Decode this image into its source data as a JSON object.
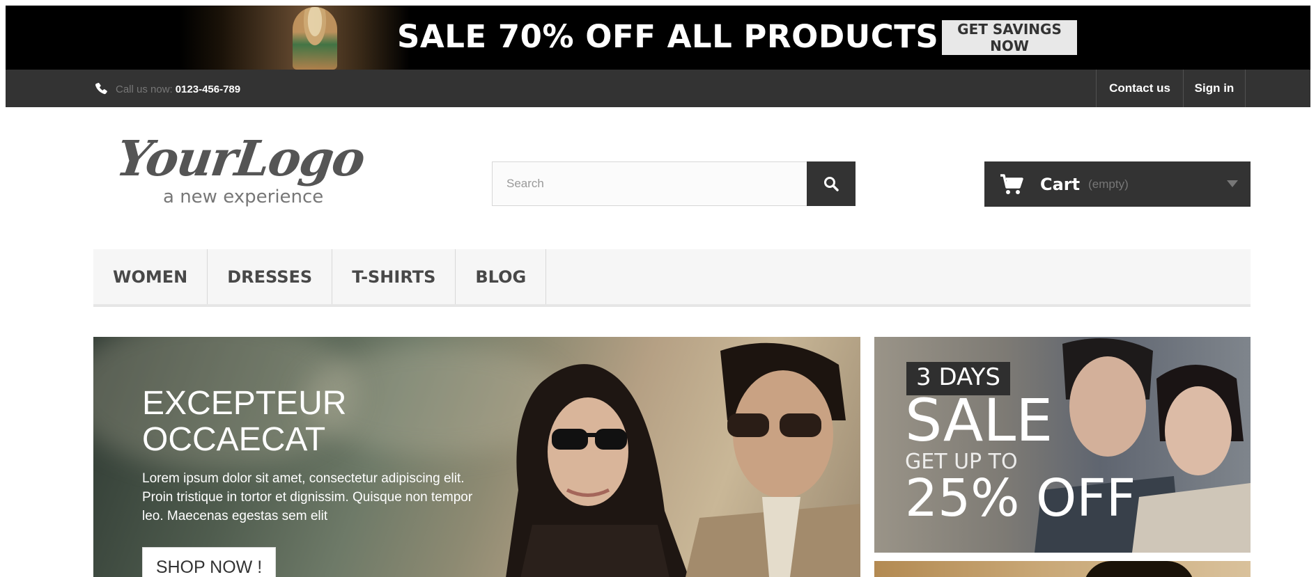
{
  "promo": {
    "headline": "SALE 70% OFF ALL PRODUCTS",
    "button": "GET SAVINGS NOW"
  },
  "topbar": {
    "call_label": "Call us now:",
    "phone": "0123-456-789",
    "contact": "Contact us",
    "signin": "Sign in"
  },
  "header": {
    "logo_script": "YourLogo",
    "logo_tagline": "a new experience",
    "search_placeholder": "Search",
    "cart_label": "Cart",
    "cart_status": "(empty)"
  },
  "nav": {
    "items": [
      "WOMEN",
      "DRESSES",
      "T-SHIRTS",
      "BLOG"
    ]
  },
  "slider": {
    "title_line1": "EXCEPTEUR",
    "title_line2": "OCCAECAT",
    "body": "Lorem ipsum dolor sit amet, consectetur adipiscing elit. Proin tristique in tortor et dignissim. Quisque non tempor leo. Maecenas egestas sem elit",
    "button": "SHOP NOW !"
  },
  "side_banner": {
    "days": "3 DAYS",
    "sale": "SALE",
    "getup": "GET UP TO",
    "percent": "25% OFF"
  },
  "colors": {
    "dark_bar": "#333333",
    "promo_bg": "#000000",
    "nav_bg": "#f6f6f6"
  }
}
